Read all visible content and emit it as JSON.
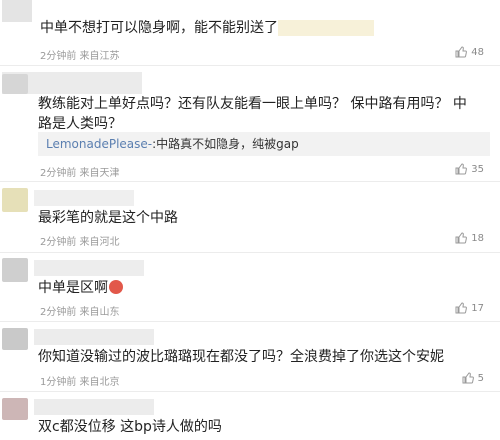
{
  "comments": [
    {
      "text": "中单不想打可以隐身啊，能不能别送了",
      "meta": "2分钟前 来自江苏",
      "likes": "48"
    },
    {
      "text": "教练能对上单好点吗？还有队友能看一眼上单吗？ 保中路有用吗？ 中路是人类吗？",
      "reply_user": "LemonadePlease-",
      "reply_text": ":中路真不如隐身，纯被gap",
      "meta": "2分钟前 来自天津",
      "likes": "35"
    },
    {
      "text": "最彩笔的就是这个中路",
      "meta": "2分钟前 来自河北",
      "likes": "18"
    },
    {
      "text": "中单是区啊",
      "meta": "2分钟前 来自山东",
      "likes": "17"
    },
    {
      "text": "你知道没输过的波比璐璐现在都没了吗？全浪费掉了你选这个安妮",
      "meta": "1分钟前 来自北京",
      "likes": "5"
    },
    {
      "text": "双c都没位移 这bp诗人做的吗"
    }
  ],
  "icons": {
    "like": "thumbs-up-icon"
  }
}
